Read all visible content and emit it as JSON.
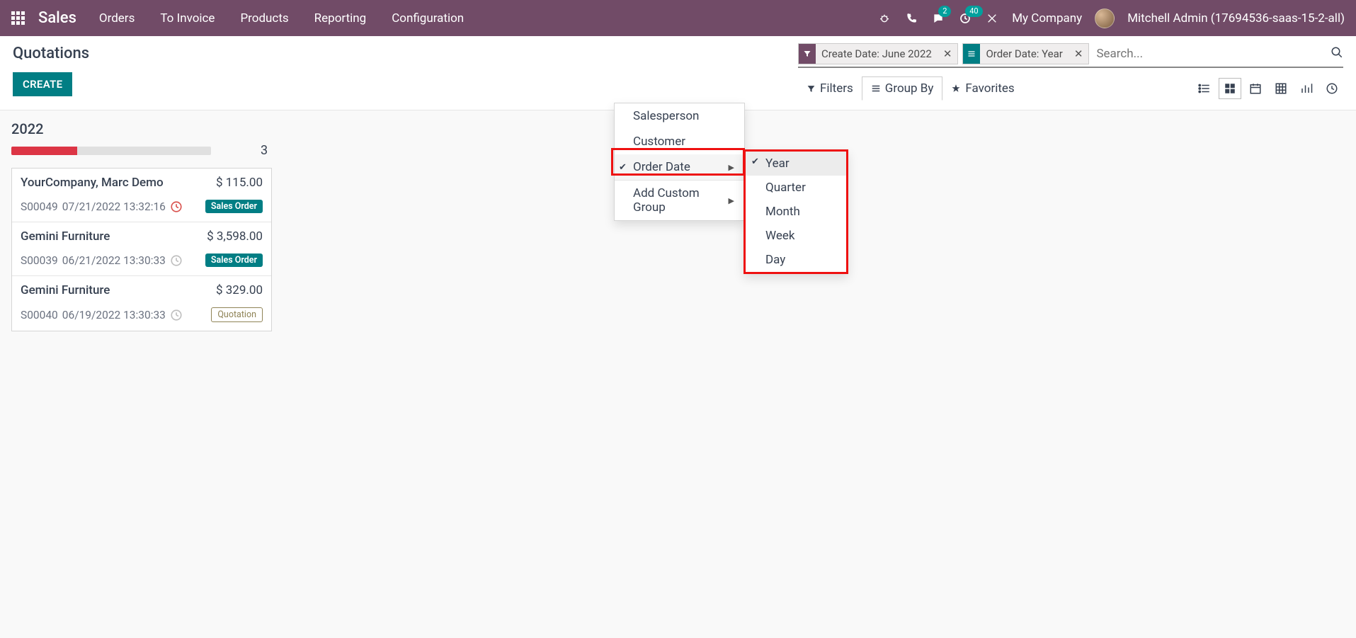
{
  "nav": {
    "brand": "Sales",
    "menu": [
      "Orders",
      "To Invoice",
      "Products",
      "Reporting",
      "Configuration"
    ],
    "msg_badge": "2",
    "act_badge": "40",
    "company": "My Company",
    "user": "Mitchell Admin (17694536-saas-15-2-all)"
  },
  "control": {
    "title": "Quotations",
    "create": "CREATE",
    "facets": [
      {
        "type": "filter",
        "label": "Create Date: June 2022"
      },
      {
        "type": "group",
        "label": "Order Date: Year"
      }
    ],
    "search_placeholder": "Search...",
    "opts": {
      "filters": "Filters",
      "groupby": "Group By",
      "favorites": "Favorites"
    }
  },
  "kanban": {
    "group_label": "2022",
    "count": "3",
    "progress_pct": "33",
    "cards": [
      {
        "customer": "YourCompany, Marc Demo",
        "amount": "$ 115.00",
        "ref": "S00049",
        "date": "07/21/2022 13:32:16",
        "late": true,
        "status": "Sales Order",
        "status_type": "so"
      },
      {
        "customer": "Gemini Furniture",
        "amount": "$ 3,598.00",
        "ref": "S00039",
        "date": "06/21/2022 13:30:33",
        "late": false,
        "status": "Sales Order",
        "status_type": "so"
      },
      {
        "customer": "Gemini Furniture",
        "amount": "$ 329.00",
        "ref": "S00040",
        "date": "06/19/2022 13:30:33",
        "late": false,
        "status": "Quotation",
        "status_type": "qt"
      }
    ]
  },
  "groupby_menu": {
    "items": [
      "Salesperson",
      "Customer",
      "Order Date"
    ],
    "checked": "Order Date",
    "add_custom": "Add Custom Group",
    "date_options": [
      "Year",
      "Quarter",
      "Month",
      "Week",
      "Day"
    ],
    "date_checked": "Year"
  }
}
